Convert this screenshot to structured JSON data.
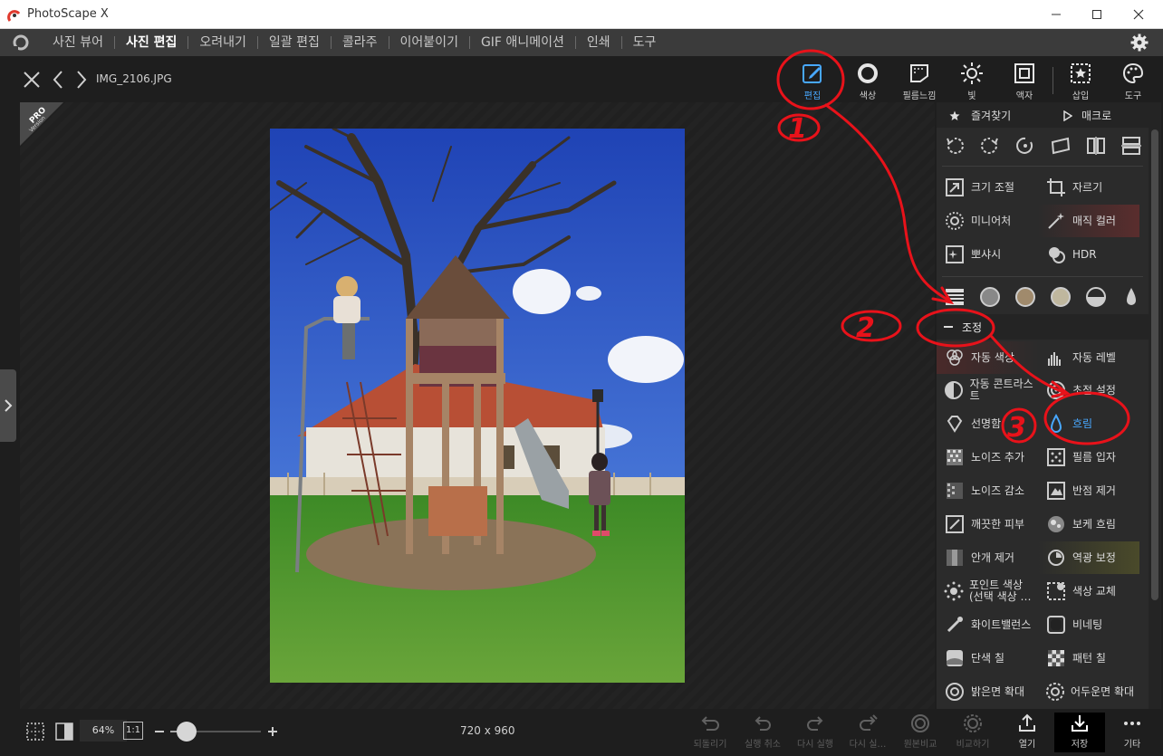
{
  "window": {
    "title": "PhotoScape X",
    "minimize_icon": "minimize-icon",
    "maximize_icon": "maximize-icon",
    "close_icon": "close-icon"
  },
  "menu": {
    "tabs": [
      {
        "label": "사진 뷰어"
      },
      {
        "label": "사진 편집",
        "active": true
      },
      {
        "label": "오려내기"
      },
      {
        "label": "일괄 편집"
      },
      {
        "label": "콜라주"
      },
      {
        "label": "이어붙이기"
      },
      {
        "label": "GIF 애니메이션"
      },
      {
        "label": "인쇄"
      },
      {
        "label": "도구"
      }
    ]
  },
  "subheader": {
    "filename": "IMG_2106.JPG",
    "tools": [
      {
        "label": "편집",
        "icon": "pencil-icon",
        "active": true
      },
      {
        "label": "색상",
        "icon": "color-circle-icon"
      },
      {
        "label": "필름느낌",
        "icon": "film-icon"
      },
      {
        "label": "빛",
        "icon": "sun-icon"
      },
      {
        "label": "액자",
        "icon": "frame-icon"
      },
      {
        "label": "삽입",
        "icon": "insert-star-icon"
      },
      {
        "label": "도구",
        "icon": "palette-icon"
      }
    ]
  },
  "badge": {
    "line1": "PRO",
    "line2": "Version"
  },
  "panel": {
    "favorites": "즐겨찾기",
    "macro": "매크로",
    "basic_items": [
      {
        "label": "크기 조절",
        "icon": "resize-icon"
      },
      {
        "label": "자르기",
        "icon": "crop-icon"
      },
      {
        "label": "미니어처",
        "icon": "miniature-icon"
      },
      {
        "label": "매직 컬러",
        "icon": "magic-wand-icon"
      },
      {
        "label": "뽀샤시",
        "icon": "sparkle-icon"
      },
      {
        "label": "HDR",
        "icon": "hdr-icon"
      }
    ],
    "section_title": "조정",
    "adjust_items": [
      {
        "label": "자동 색상",
        "icon": "auto-color-icon"
      },
      {
        "label": "자동 레벨",
        "icon": "auto-level-icon"
      },
      {
        "label": "자동 콘트라스트",
        "icon": "auto-contrast-icon"
      },
      {
        "label": "초점 설정",
        "icon": "focus-icon"
      },
      {
        "label": "선명함",
        "icon": "diamond-icon"
      },
      {
        "label": "흐림",
        "icon": "drop-icon",
        "active": true
      },
      {
        "label": "노이즈 추가",
        "icon": "noise-add-icon"
      },
      {
        "label": "필름 입자",
        "icon": "film-grain-icon"
      },
      {
        "label": "노이즈 감소",
        "icon": "noise-reduce-icon"
      },
      {
        "label": "반점 제거",
        "icon": "spot-remove-icon"
      },
      {
        "label": "깨끗한 피부",
        "icon": "clean-skin-icon"
      },
      {
        "label": "보케 흐림",
        "icon": "bokeh-icon"
      },
      {
        "label": "안개 제거",
        "icon": "dehaze-icon"
      },
      {
        "label": "역광 보정",
        "icon": "backlight-icon"
      },
      {
        "label": "포인트 색상 (선택 색상 …",
        "icon": "point-color-icon"
      },
      {
        "label": "색상 교체",
        "icon": "color-replace-icon"
      },
      {
        "label": "화이트밸런스",
        "icon": "white-balance-icon"
      },
      {
        "label": "비네팅",
        "icon": "vignette-icon"
      },
      {
        "label": "단색 칠",
        "icon": "solid-fill-icon"
      },
      {
        "label": "패턴 칠",
        "icon": "pattern-fill-icon"
      },
      {
        "label": "밝은면 확대",
        "icon": "expand-light-icon"
      },
      {
        "label": "어두운면 확대",
        "icon": "expand-dark-icon"
      }
    ]
  },
  "bottom": {
    "zoom": "64%",
    "one_to_one": "1:1",
    "zoom_level": 0.18,
    "dimensions": "720 x 960",
    "buttons": [
      {
        "label": "되돌리기",
        "icon": "revert-icon",
        "dim": true
      },
      {
        "label": "실행 취소",
        "icon": "undo-icon",
        "dim": true
      },
      {
        "label": "다시 실행",
        "icon": "redo-icon",
        "dim": true
      },
      {
        "label": "다시 실…",
        "icon": "redo-all-icon",
        "dim": true
      },
      {
        "label": "원본비교",
        "icon": "compare-original-icon",
        "dim": true
      },
      {
        "label": "비교하기",
        "icon": "compare-icon",
        "dim": true
      },
      {
        "label": "열기",
        "icon": "open-icon"
      },
      {
        "label": "저장",
        "icon": "save-icon",
        "active": true
      },
      {
        "label": "기타",
        "icon": "more-icon"
      }
    ]
  },
  "annotations": {
    "step1": "1",
    "step2": "2",
    "step3": "3"
  }
}
